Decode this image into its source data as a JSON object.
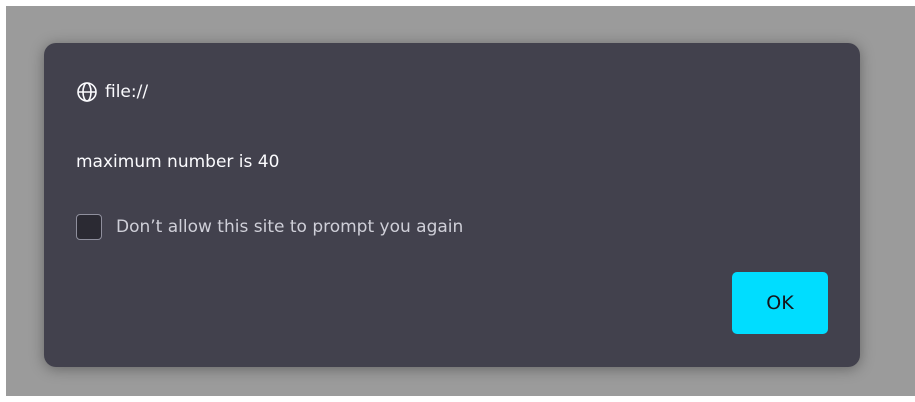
{
  "dialog": {
    "origin": "file://",
    "origin_icon": "globe-icon",
    "message": "maximum number is 40",
    "checkbox_label": "Don’t allow this site to prompt you again",
    "checkbox_checked": false,
    "ok_label": "OK"
  },
  "colors": {
    "backdrop": "#9b9b9b",
    "dialog_bg": "#42414d",
    "accent": "#00ddff",
    "text": "#fbfbfe"
  }
}
